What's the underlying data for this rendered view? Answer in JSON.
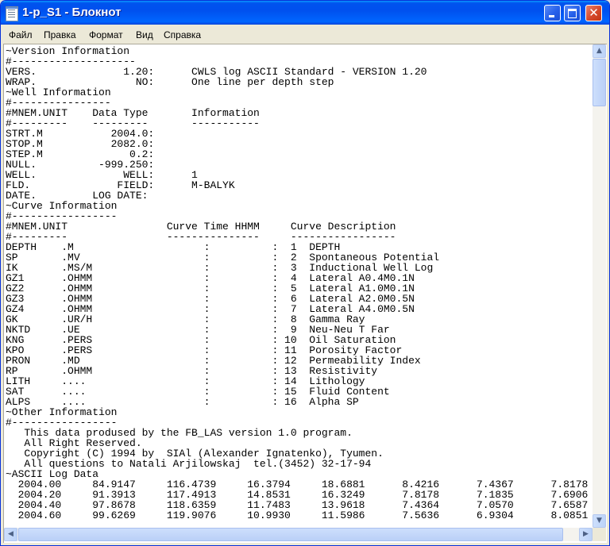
{
  "window": {
    "title": "1-p_S1 - Блокнот",
    "icon": "notepad-icon",
    "controls": {
      "minimize_icon": "minimize-icon",
      "maximize_icon": "maximize-icon",
      "close_icon": "close-icon"
    },
    "colors": {
      "titlebar": "#0054e3",
      "close_button": "#d5482b",
      "text_background": "#ffffff"
    }
  },
  "menu": {
    "file": "Файл",
    "edit": "Правка",
    "format": "Формат",
    "view": "Вид",
    "help": "Справка"
  },
  "document": {
    "lines": [
      "~Version Information",
      "#--------------------",
      "VERS.              1.20:      CWLS log ASCII Standard - VERSION 1.20",
      "WRAP.                NO:      One line per depth step",
      "~Well Information",
      "#----------------",
      "#MNEM.UNIT    Data Type       Information",
      "#---------    ---------       -----------",
      "STRT.M           2004.0:",
      "STOP.M           2082.0:",
      "STEP.M              0.2:",
      "NULL.          -999.250:",
      "WELL.              WELL:      1",
      "FLD.              FIELD:      M-BALYK",
      "DATE.         LOG DATE:",
      "~Curve Information",
      "#-----------------",
      "#MNEM.UNIT                Curve Time HHMM     Curve Description",
      "#---------                ---------------     -----------------",
      "DEPTH    .M                     :          :  1  DEPTH",
      "SP       .MV                    :          :  2  Spontaneous Potential",
      "IK       .MS/M                  :          :  3  Inductional Well Log",
      "GZ1      .OHMM                  :          :  4  Lateral A0.4M0.1N",
      "GZ2      .OHMM                  :          :  5  Lateral A1.0M0.1N",
      "GZ3      .OHMM                  :          :  6  Lateral A2.0M0.5N",
      "GZ4      .OHMM                  :          :  7  Lateral A4.0M0.5N",
      "GK       .UR/H                  :          :  8  Gamma Ray",
      "NKTD     .UE                    :          :  9  Neu-Neu T Far",
      "KNG      .PERS                  :          : 10  Oil Saturation",
      "KPO      .PERS                  :          : 11  Porosity Factor",
      "PRON     .MD                    :          : 12  Permeability Index",
      "RP       .OHMM                  :          : 13  Resistivity",
      "LITH     ....                   :          : 14  Lithology",
      "SAT      ....                   :          : 15  Fluid Content",
      "ALPS     ....                   :          : 16  Alpha SP",
      "~Other Information",
      "#-----------------",
      "   This data prodused by the FB_LAS version 1.0 program.",
      "   All Right Reserved.",
      "   Copyright (C) 1994 by  SIAl (Alexander Ignatenko), Tyumen.",
      "   All questions to Natali Arjilowskaj  tel.(3452) 32-17-94",
      "~ASCII Log Data",
      "  2004.00     84.9147     116.4739     16.3794     18.6881      8.4216      7.4367      7.8178",
      "  2004.20     91.3913     117.4913     14.8531     16.3249      7.8178      7.1835      7.6906",
      "  2004.40     97.8678     118.6359     11.7483     13.9618      7.4364      7.0570      7.6587",
      "  2004.60     99.6269     119.9076     10.9930     11.5986      7.5636      6.9304      8.0851"
    ]
  },
  "scrollbars": {
    "up_arrow": "▲",
    "down_arrow": "▼",
    "left_arrow": "◀",
    "right_arrow": "▶"
  }
}
